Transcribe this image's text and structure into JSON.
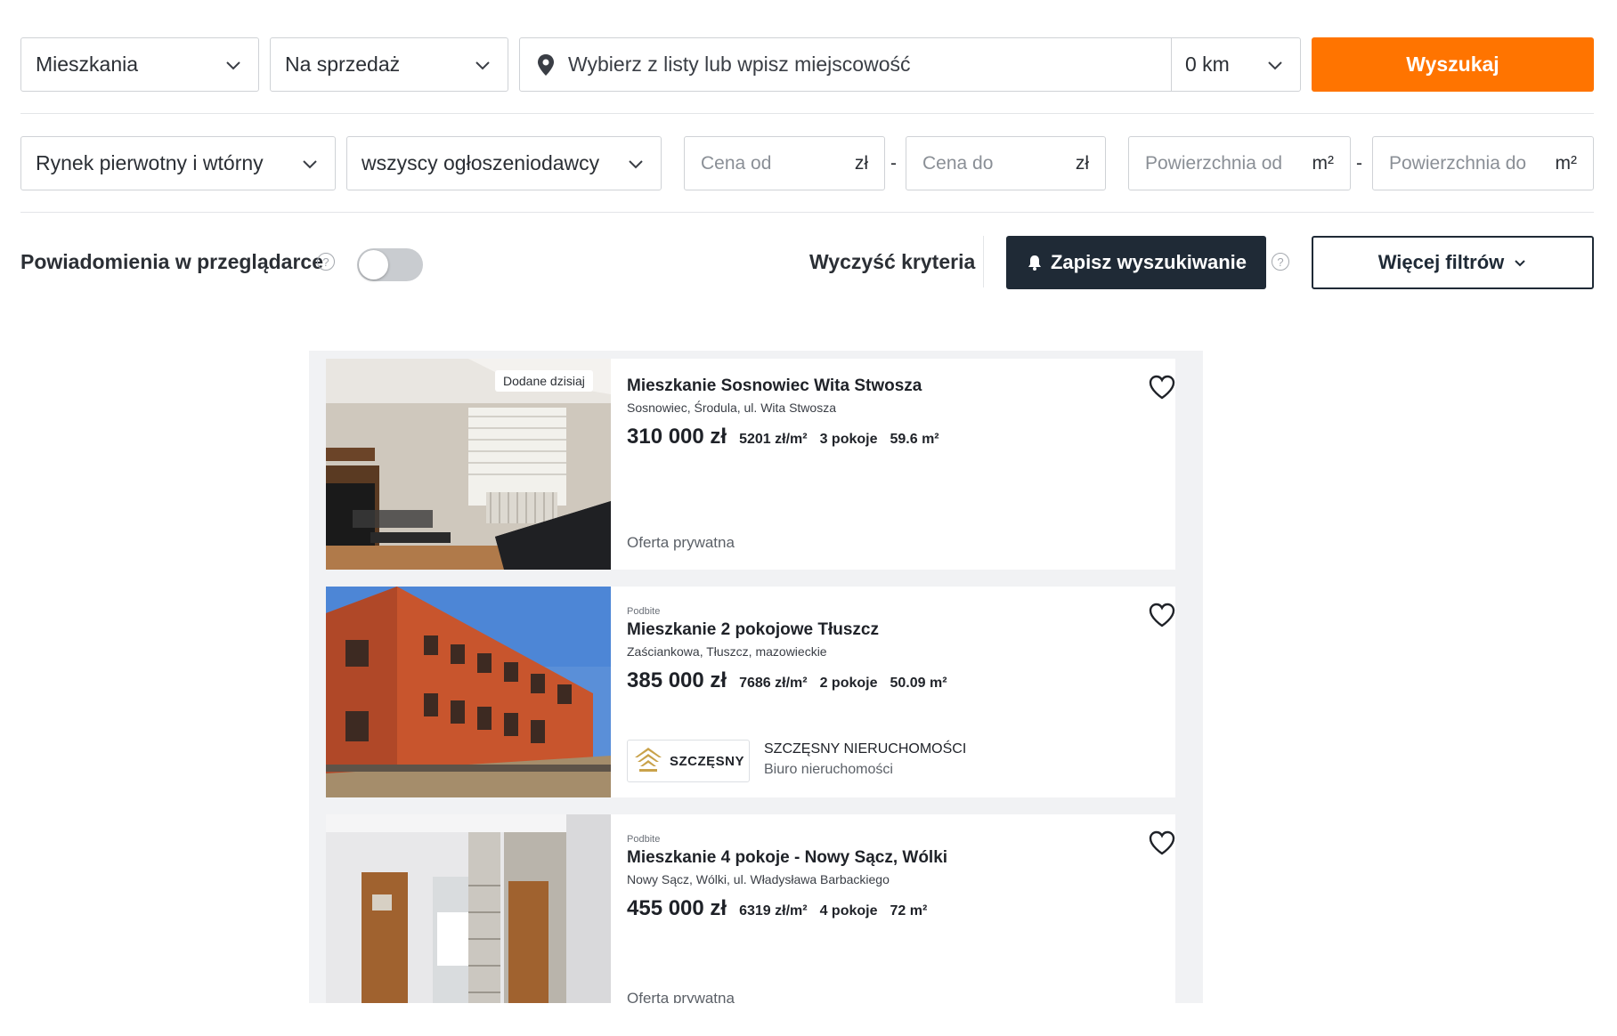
{
  "search": {
    "property_type": "Mieszkania",
    "deal_type": "Na sprzedaż",
    "location_placeholder": "Wybierz z listy lub wpisz miejscowość",
    "radius": "0 km",
    "search_button": "Wyszukaj"
  },
  "filters": {
    "market": "Rynek pierwotny i wtórny",
    "advertiser": "wszyscy ogłoszeniodawcy",
    "price_from_placeholder": "Cena od",
    "price_to_placeholder": "Cena do",
    "price_unit": "zł",
    "area_from_placeholder": "Powierzchnia od",
    "area_to_placeholder": "Powierzchnia do",
    "area_unit": "m²",
    "range_separator": "-"
  },
  "actions": {
    "notifications_label": "Powiadomienia w przeglądarce",
    "notifications_enabled": false,
    "help_glyph": "?",
    "clear_criteria": "Wyczyść kryteria",
    "save_search": "Zapisz wyszukiwanie",
    "more_filters": "Więcej filtrów"
  },
  "listings": [
    {
      "badge": "Dodane dzisiaj",
      "promoted": "",
      "title": "Mieszkanie Sosnowiec Wita Stwosza",
      "address": "Sosnowiec, Środula, ul. Wita Stwosza",
      "price": "310 000 zł",
      "price_per_m2": "5201 zł/m²",
      "rooms": "3 pokoje",
      "area": "59.6 m²",
      "seller": "Oferta prywatna",
      "image": "living-room-photo"
    },
    {
      "badge": "",
      "promoted": "Podbite",
      "title": "Mieszkanie 2 pokojowe Tłuszcz",
      "address": "Zaściankowa, Tłuszcz, mazowieckie",
      "price": "385 000 zł",
      "price_per_m2": "7686 zł/m²",
      "rooms": "2 pokoje",
      "area": "50.09 m²",
      "agency_logo_text": "SZCZĘSNY",
      "agency_name": "SZCZĘSNY NIERUCHOMOŚCI",
      "agency_type": "Biuro nieruchomości",
      "image": "brick-building-photo"
    },
    {
      "badge": "",
      "promoted": "Podbite",
      "title": "Mieszkanie 4 pokoje - Nowy Sącz, Wólki",
      "address": "Nowy Sącz, Wólki, ul. Władysława Barbackiego",
      "price": "455 000 zł",
      "price_per_m2": "6319 zł/m²",
      "rooms": "4 pokoje",
      "area": "72 m²",
      "seller": "Oferta prywatna",
      "image": "hallway-photo"
    }
  ],
  "colors": {
    "accent": "#ff7400",
    "dark_button": "#1f2a36",
    "border": "#cfd2d6"
  }
}
